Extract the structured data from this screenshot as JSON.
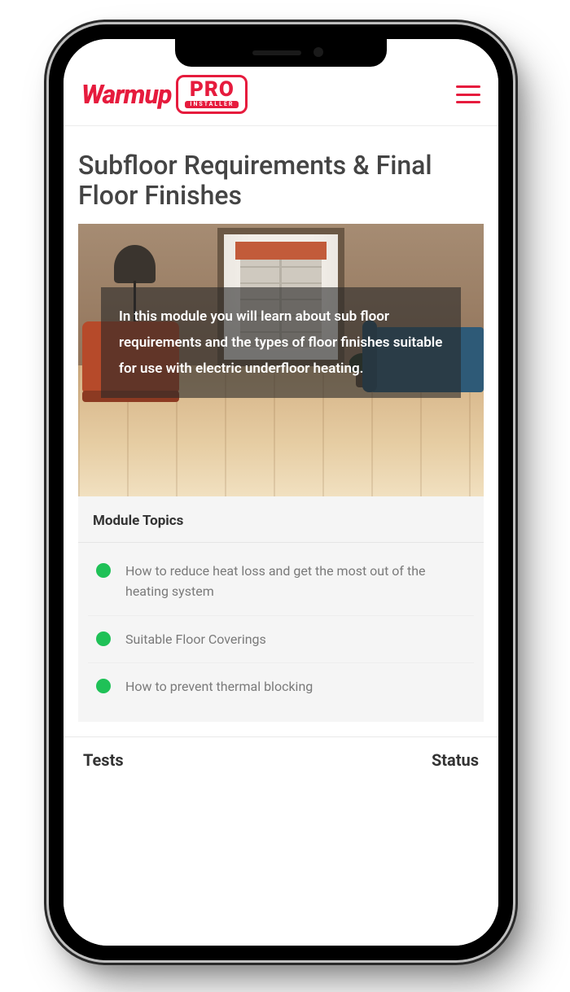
{
  "header": {
    "brand_main": "Warmup",
    "brand_badge_big": "PRO",
    "brand_badge_small": "INSTALLER"
  },
  "page": {
    "title": "Subfloor Requirements & Final Floor Finishes",
    "intro": "In this module you will learn about sub floor requirements and the types of floor finishes suitable for use with electric underfloor heating."
  },
  "module": {
    "heading": "Module Topics",
    "topics": [
      "How to reduce heat loss and get the most out of the heating system",
      "Suitable Floor Coverings",
      "How to prevent thermal blocking"
    ]
  },
  "bottom": {
    "left": "Tests",
    "right": "Status"
  }
}
